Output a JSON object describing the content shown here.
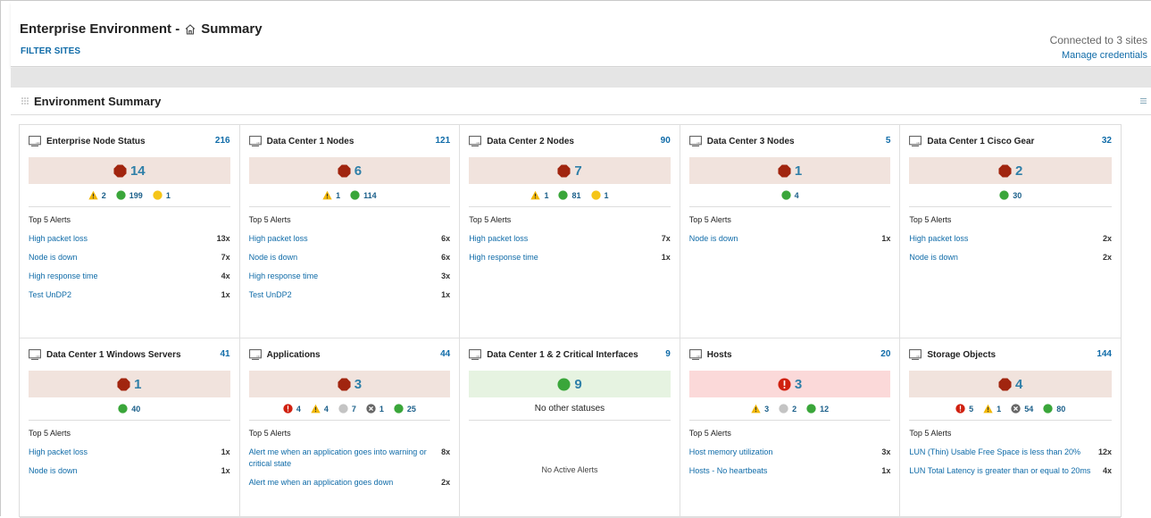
{
  "header": {
    "title": "Enterprise Environment -",
    "title_suffix": "Summary",
    "filter_sites": "FILTER SITES",
    "connected": "Connected to 3 sites",
    "manage": "Manage credentials"
  },
  "panel": {
    "title": "Environment Summary"
  },
  "tiles": [
    {
      "title": "Enterprise Node Status",
      "count": "216",
      "band": "stop",
      "main": "14",
      "statuses": [
        {
          "type": "warning",
          "value": "2"
        },
        {
          "type": "up",
          "value": "199"
        },
        {
          "type": "minor",
          "value": "1"
        }
      ],
      "alerts_title": "Top 5 Alerts",
      "alerts": [
        {
          "name": "High packet loss",
          "count": "13x"
        },
        {
          "name": "Node is down",
          "count": "7x"
        },
        {
          "name": "High response time",
          "count": "4x"
        },
        {
          "name": "Test UnDP2",
          "count": "1x"
        }
      ]
    },
    {
      "title": "Data Center 1 Nodes",
      "count": "121",
      "band": "stop",
      "main": "6",
      "statuses": [
        {
          "type": "warning",
          "value": "1"
        },
        {
          "type": "up",
          "value": "114"
        }
      ],
      "alerts_title": "Top 5 Alerts",
      "alerts": [
        {
          "name": "High packet loss",
          "count": "6x"
        },
        {
          "name": "Node is down",
          "count": "6x"
        },
        {
          "name": "High response time",
          "count": "3x"
        },
        {
          "name": "Test UnDP2",
          "count": "1x"
        }
      ]
    },
    {
      "title": "Data Center 2 Nodes",
      "count": "90",
      "band": "stop",
      "main": "7",
      "statuses": [
        {
          "type": "warning",
          "value": "1"
        },
        {
          "type": "up",
          "value": "81"
        },
        {
          "type": "minor",
          "value": "1"
        }
      ],
      "alerts_title": "Top 5 Alerts",
      "alerts": [
        {
          "name": "High packet loss",
          "count": "7x"
        },
        {
          "name": "High response time",
          "count": "1x"
        }
      ]
    },
    {
      "title": "Data Center 3 Nodes",
      "count": "5",
      "band": "stop",
      "main": "1",
      "statuses": [
        {
          "type": "up",
          "value": "4"
        }
      ],
      "alerts_title": "Top 5 Alerts",
      "alerts": [
        {
          "name": "Node is down",
          "count": "1x"
        }
      ]
    },
    {
      "title": "Data Center 1 Cisco Gear",
      "count": "32",
      "band": "stop",
      "main": "2",
      "statuses": [
        {
          "type": "up",
          "value": "30"
        }
      ],
      "alerts_title": "Top 5 Alerts",
      "alerts": [
        {
          "name": "High packet loss",
          "count": "2x"
        },
        {
          "name": "Node is down",
          "count": "2x"
        }
      ]
    },
    {
      "title": "Data Center 1 Windows Servers",
      "count": "41",
      "band": "stop",
      "main": "1",
      "statuses": [
        {
          "type": "up",
          "value": "40"
        }
      ],
      "alerts_title": "Top 5 Alerts",
      "alerts": [
        {
          "name": "High packet loss",
          "count": "1x"
        },
        {
          "name": "Node is down",
          "count": "1x"
        }
      ]
    },
    {
      "title": "Applications",
      "count": "44",
      "band": "stop",
      "main": "3",
      "statuses": [
        {
          "type": "critical",
          "value": "4"
        },
        {
          "type": "warning",
          "value": "4"
        },
        {
          "type": "unknown",
          "value": "7"
        },
        {
          "type": "unmanaged",
          "value": "1"
        },
        {
          "type": "up",
          "value": "25"
        }
      ],
      "alerts_title": "Top 5 Alerts",
      "alerts": [
        {
          "name": "Alert me when an application goes into warning or critical state",
          "count": "8x"
        },
        {
          "name": "Alert me when an application goes down",
          "count": "2x"
        }
      ]
    },
    {
      "title": "Data Center 1 & 2 Critical Interfaces",
      "count": "9",
      "band": "up",
      "main": "9",
      "statuses": [],
      "no_other": "No other statuses",
      "no_alerts": "No Active Alerts",
      "alerts": []
    },
    {
      "title": "Hosts",
      "count": "20",
      "band": "critical",
      "main": "3",
      "statuses": [
        {
          "type": "warning",
          "value": "3"
        },
        {
          "type": "unknown",
          "value": "2"
        },
        {
          "type": "up",
          "value": "12"
        }
      ],
      "alerts_title": "Top 5 Alerts",
      "alerts": [
        {
          "name": "Host memory utilization",
          "count": "3x"
        },
        {
          "name": "Hosts - No heartbeats",
          "count": "1x"
        }
      ]
    },
    {
      "title": "Storage Objects",
      "count": "144",
      "band": "stop",
      "main": "4",
      "statuses": [
        {
          "type": "critical",
          "value": "5"
        },
        {
          "type": "warning",
          "value": "1"
        },
        {
          "type": "unmanaged",
          "value": "54"
        },
        {
          "type": "up",
          "value": "80"
        }
      ],
      "alerts_title": "Top 5 Alerts",
      "alerts": [
        {
          "name": "LUN (Thin) Usable Free Space is less than 20%",
          "count": "12x"
        },
        {
          "name": "LUN Total Latency is greater than or equal to 20ms",
          "count": "4x"
        }
      ]
    }
  ],
  "colors": {
    "stop": "#a1250f",
    "up": "#3aa63a",
    "warning": "#f2b705",
    "minor": "#f5c518",
    "critical": "#d0200f",
    "unknown": "#c4c4c4",
    "unmanaged": "#666666",
    "link": "#0f6ba8"
  },
  "icons": {
    "home": "home-icon",
    "drag": "drag-handle-icon",
    "menu": "menu-icon",
    "tile": "monitor-icon",
    "stop": "octagon-down-icon",
    "up": "green-circle-icon",
    "warning": "warning-triangle-icon",
    "minor": "yellow-circle-icon",
    "critical": "critical-exclamation-icon",
    "unknown": "grey-circle-icon",
    "unmanaged": "unmanaged-x-icon"
  }
}
